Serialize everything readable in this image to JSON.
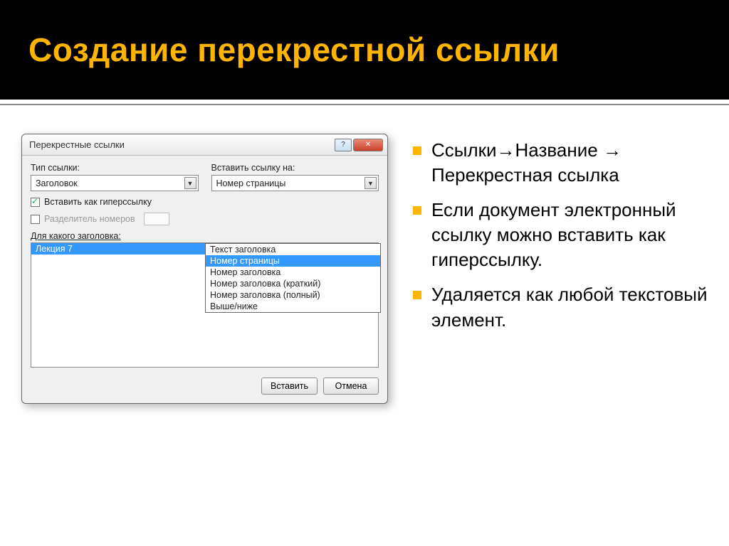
{
  "slide": {
    "title": "Создание перекрестной ссылки"
  },
  "dialog": {
    "title": "Перекрестные ссылки",
    "link_type_label": "Тип ссылки:",
    "link_type_value": "Заголовок",
    "insert_ref_label": "Вставить ссылку на:",
    "insert_ref_value": "Номер страницы",
    "insert_as_hyperlink": "Вставить как гиперссылку",
    "separator_label": "Разделитель номеров",
    "for_heading_label": "Для какого заголовка:",
    "heading_item": "Лекция 7",
    "dropdown_options": [
      "Текст заголовка",
      "Номер страницы",
      "Номер заголовка",
      "Номер заголовка (краткий)",
      "Номер заголовка (полный)",
      "Выше/ниже"
    ],
    "btn_insert": "Вставить",
    "btn_cancel": "Отмена"
  },
  "bullets": [
    "Ссылки→Название → Перекрестная ссылка",
    "Если документ электронный ссылку можно вставить как гиперссылку.",
    "Удаляется как любой текстовый элемент."
  ]
}
